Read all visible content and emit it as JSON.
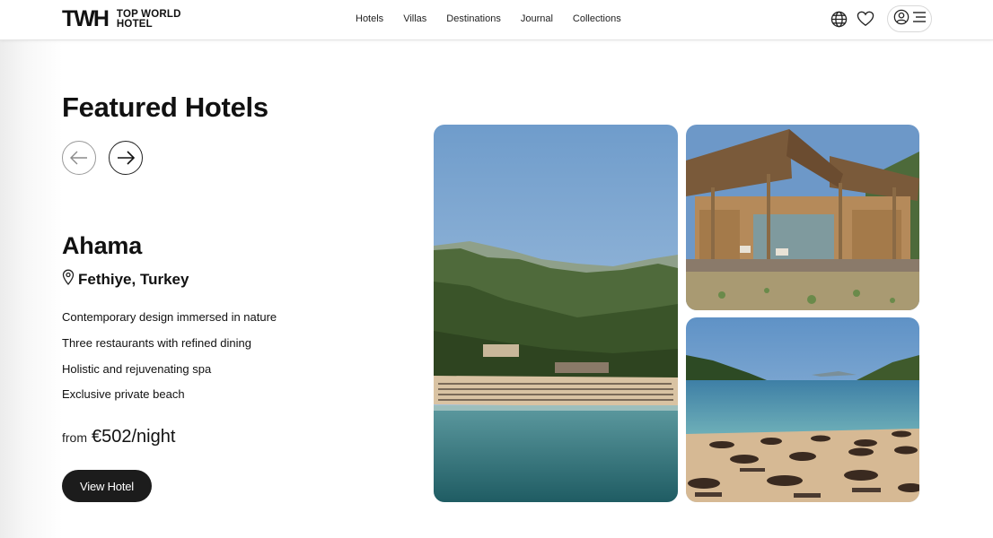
{
  "brand": {
    "mark": "TWH",
    "line1": "TOP WORLD",
    "line2": "HOTEL"
  },
  "nav": [
    {
      "label": "Hotels"
    },
    {
      "label": "Villas"
    },
    {
      "label": "Destinations"
    },
    {
      "label": "Journal"
    },
    {
      "label": "Collections"
    }
  ],
  "header_icons": [
    "globe-icon",
    "heart-icon",
    "user-icon",
    "menu-icon"
  ],
  "section": {
    "title": "Featured Hotels",
    "prev_icon": "arrow-left-icon",
    "next_icon": "arrow-right-icon"
  },
  "hotel": {
    "name": "Ahama",
    "location": "Fethiye, Turkey",
    "location_icon": "map-pin-icon",
    "features": [
      "Contemporary design immersed in nature",
      "Three restaurants with refined dining",
      "Holistic and rejuvenating spa",
      "Exclusive private beach"
    ],
    "price_prefix": "from",
    "price": "€502/night",
    "cta": "View Hotel"
  },
  "colors": {
    "button_bg": "#1c1c1c",
    "text": "#111111",
    "sky": "#7fa7cf",
    "sea": "#2f6f78",
    "sand": "#d9c3a3"
  }
}
